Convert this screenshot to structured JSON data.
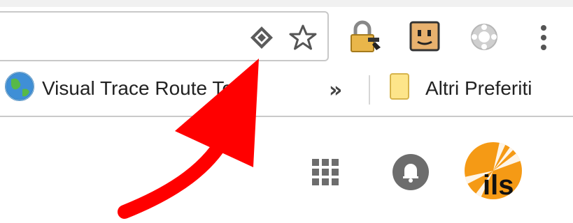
{
  "colors": {
    "arrow": "#ff0000",
    "avatar_orange": "#f59a15",
    "folder_yellow": "#fde58a",
    "notification_gray": "#6d6d6d"
  },
  "omnibox": {
    "value": "",
    "icons": [
      "page-translate-icon",
      "bookmark-star-icon"
    ]
  },
  "extensions": [
    "lock-key-icon",
    "face-box-icon",
    "lifebuoy-icon",
    "more-menu-icon"
  ],
  "bookmarks_bar": {
    "items": [
      {
        "icon": "globe-icon",
        "label": "Visual Trace Route Tool"
      }
    ],
    "overflow_label": "»",
    "other_bookmarks": {
      "icon": "folder-icon",
      "label": "Altri Preferiti"
    }
  },
  "page_header": {
    "icons": [
      "apps-grid-icon",
      "notifications-bell-icon"
    ],
    "avatar_label": "ils"
  },
  "annotation": {
    "type": "arrow",
    "color": "#ff0000"
  }
}
